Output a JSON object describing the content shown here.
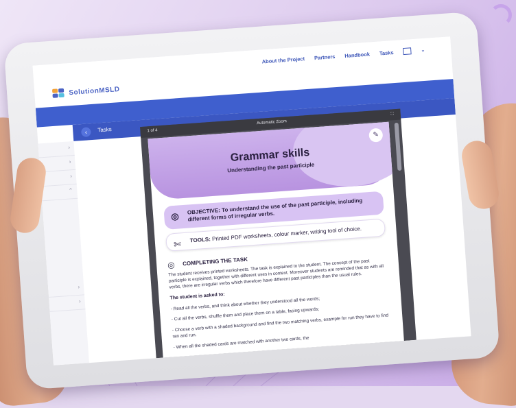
{
  "site": {
    "logo_text": "SolutionMSLD",
    "nav": [
      "About the Project",
      "Partners",
      "Handbook",
      "Tasks"
    ],
    "breadcrumb": "Tasks"
  },
  "viewer": {
    "toolbar_left": "1 of 4",
    "zoom": "Automatic Zoom"
  },
  "worksheet": {
    "title": "Grammar skills",
    "subtitle": "Understanding the past participle",
    "objective": "OBJECTIVE: To understand the use of the past participle, including different forms of irregular verbs.",
    "tools_label": "TOOLS:",
    "tools": "Printed PDF worksheets, colour marker, writing tool of choice.",
    "completing_heading": "COMPLETING THE TASK",
    "completing_text": "The student receives printed worksheets. The task is explained to the student. The concept of the past participle is explained, together with different uses in context. Moreover students are reminded that as with all verbs, there are irregular verbs which therefore have different past participles than the usual rules.",
    "asked_heading": "The student is asked to:",
    "steps": [
      "- Read all the verbs, and think about whether they understood all the words;",
      "- Cut all the verbs, shuffle them and place them on a table, facing upwards;",
      "- Choose a verb with a shaded background and find the two matching verbs, example for run they have to find ran and run.",
      "- When all the shaded cards are matched with another two cards, the"
    ]
  },
  "colors": {
    "brand_blue": "#3f5fce",
    "worksheet_purple": "#b893e0",
    "background": "#e4d8f0"
  }
}
